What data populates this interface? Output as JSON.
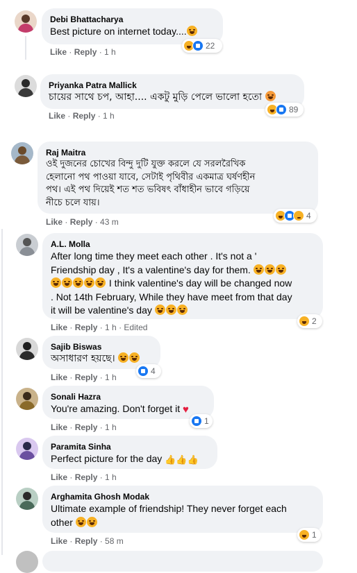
{
  "comments": [
    {
      "name": "Debi Bhattacharya",
      "text": "Best picture on internet today....",
      "emoji": "haha",
      "like": "Like",
      "reply": "Reply",
      "time": "1 h",
      "reactions": "22",
      "avatar_color": "#c43d6b"
    },
    {
      "name": "Priyanka Patra Mallick",
      "text": "চায়ের সাথে চপ, আহা.... একটু মুড়ি পেলে ভালো হতো",
      "emoji": "orange",
      "like": "Like",
      "reply": "Reply",
      "time": "1 h",
      "reactions": "89",
      "avatar_color": "#3a3a3a"
    },
    {
      "name": "Raj Maitra",
      "lines": [
        "ওই দুজনের চোখের বিন্দু দুটি যুক্ত করলে যে সরলরৈখিক",
        "হেলানো পথ পাওয়া যাবে, সেটাই পৃথিবীর একমাত্র ঘর্ষণহীন",
        "পথ। এই পথ দিয়েই শত শত ভবিষৎ বাঁধাহীন ভাবে গড়িয়ে",
        "নীচে চলে যায়।"
      ],
      "like": "Like",
      "reply": "Reply",
      "time": "43 m",
      "reactions": "4",
      "avatar_color": "#7a5a3a"
    },
    {
      "name": "A.L. Molla",
      "lines": [
        "After long time they meet each other . It's not a '",
        "Friendship day , It's a valentine's day for them.",
        "I think valentine's day will be changed now",
        ". Not 14th February, While they have meet from that day",
        "it will be valentine's day"
      ],
      "like": "Like",
      "reply": "Reply",
      "time": "1 h",
      "edited": "Edited",
      "reactions": "2",
      "avatar_color": "#8a8f96"
    },
    {
      "name": "Sajib Biswas",
      "text": "অসাধারণ হয়ছে।",
      "like": "Like",
      "reply": "Reply",
      "time": "1 h",
      "reactions": "4",
      "avatar_color": "#2b2b2b"
    },
    {
      "name": "Sonali Hazra",
      "text": "You're amazing. Don't forget it",
      "like": "Like",
      "reply": "Reply",
      "time": "1 h",
      "reactions": "1",
      "avatar_color": "#8a6a2a"
    },
    {
      "name": "Paramita Sinha",
      "text": "Perfect picture for the day",
      "like": "Like",
      "reply": "Reply",
      "time": "1 h",
      "avatar_color": "#6b4fa0"
    },
    {
      "name": "Arghamita Ghosh Modak",
      "lines": [
        "Ultimate example of friendship! They never forget each",
        "other"
      ],
      "like": "Like",
      "reply": "Reply",
      "time": "58 m",
      "reactions": "1",
      "avatar_color": "#4a6a5a"
    }
  ],
  "dot": "·"
}
